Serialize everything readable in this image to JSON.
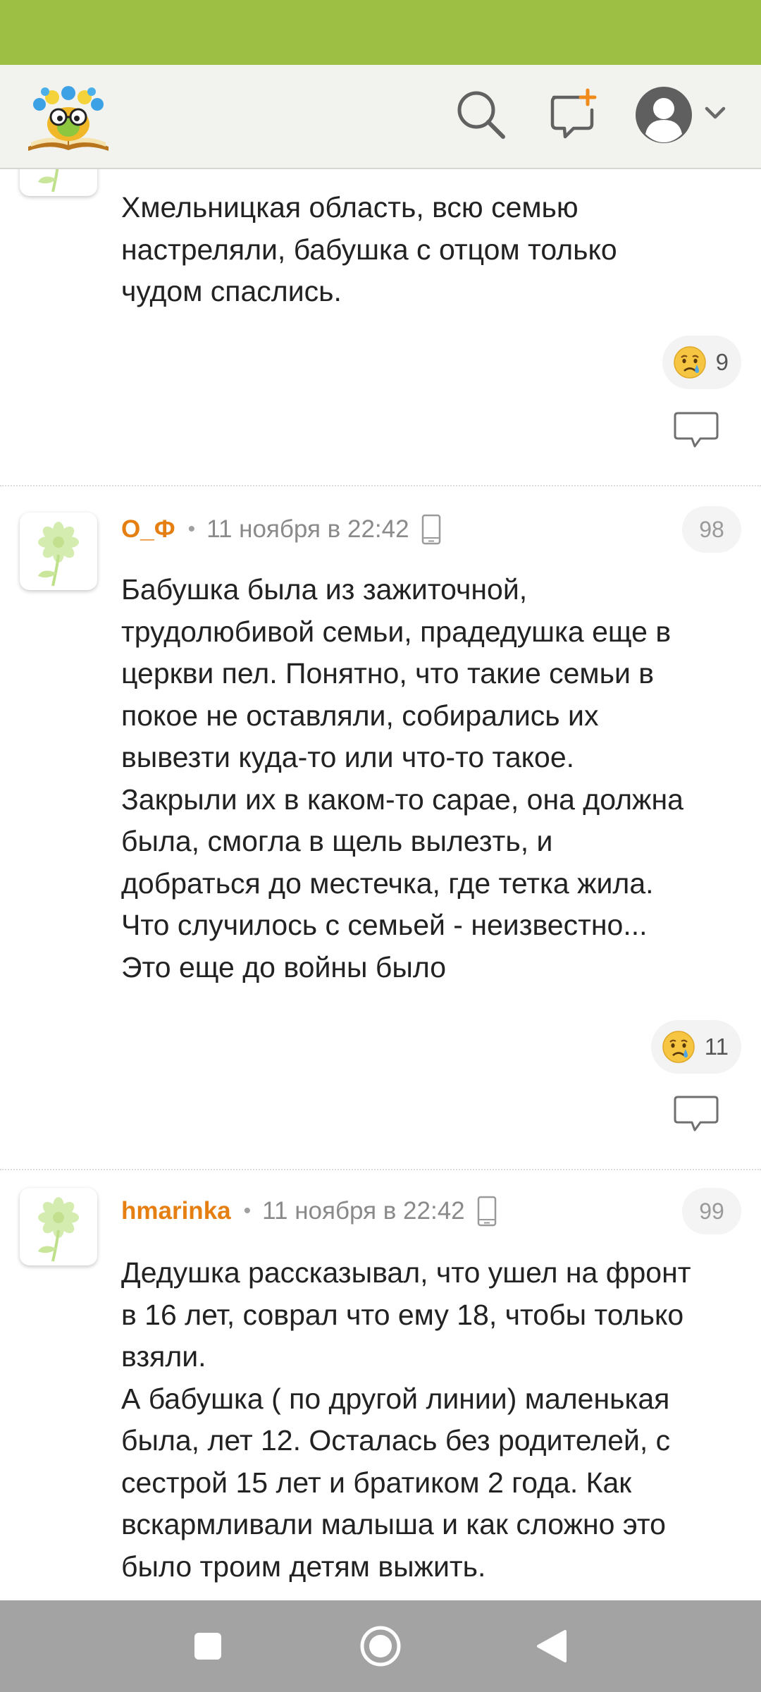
{
  "colors": {
    "status_bar": "#9dc044",
    "header_bg": "#f2f2ee",
    "username": "#e57f12",
    "nav_bar": "#a3a3a3"
  },
  "header": {
    "logo": "site-logo-flower-book",
    "icons": [
      "search-icon",
      "compose-icon",
      "user-avatar-icon",
      "chevron-down-icon"
    ]
  },
  "comments": [
    {
      "text_lines": [
        "Хмельницкая область, всю семью",
        "настреляли, бабушка с отцом только",
        "чудом спаслись."
      ],
      "reaction_icon": "crying-face-icon",
      "reaction_count": "9"
    },
    {
      "username": "О_Ф",
      "timestamp": "11 ноября в 22:42",
      "number": "98",
      "text_lines": [
        "Бабушка была из зажиточной,",
        "трудолюбивой семьи, прадедушка еще в",
        "церкви пел. Понятно, что такие семьи в",
        "покое не оставляли, собирались их",
        "вывезти куда-то или что-то такое.",
        "Закрыли их в каком-то сарае, она должна",
        "была, смогла в щель вылезть, и",
        "добраться до местечка, где тетка жила.",
        "Что случилось с семьей - неизвестно...",
        "Это еще до войны было"
      ],
      "reaction_icon": "crying-face-icon",
      "reaction_count": "11"
    },
    {
      "username": "hmarinka",
      "timestamp": "11 ноября в 22:42",
      "number": "99",
      "text_lines": [
        "Дедушка рассказывал, что ушел на фронт",
        "в 16 лет, соврал что ему 18, чтобы только",
        "взяли.",
        "А бабушка ( по другой линии) маленькая",
        "была, лет 12. Осталась без родителей, с",
        "сестрой 15 лет и братиком 2 года. Как",
        "вскармливали малыша и как сложно это",
        "было троим детям выжить."
      ]
    }
  ],
  "nav": {
    "icons": [
      "recents-square-icon",
      "home-circle-icon",
      "back-triangle-icon"
    ]
  }
}
